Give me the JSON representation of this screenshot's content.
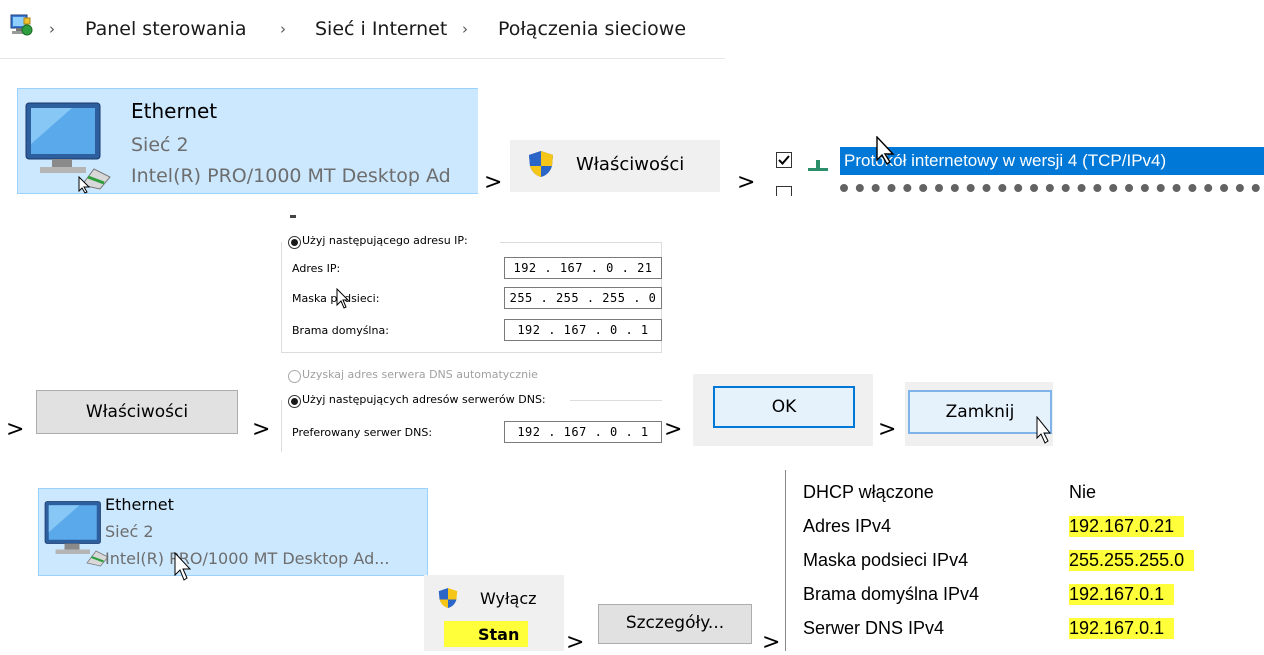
{
  "breadcrumb": {
    "icon": "control-panel-icon",
    "items": [
      "Panel sterowania",
      "Sieć i Internet",
      "Połączenia sieciowe"
    ]
  },
  "adapter": {
    "name": "Ethernet",
    "network": "Sieć 2",
    "device_truncated": "Intel(R) PRO/1000 MT Desktop Ad",
    "device_ellipsis": "Intel(R) PRO/1000 MT Desktop Ad..."
  },
  "menu": {
    "properties": "Właściwości",
    "disable": "Wyłącz",
    "status": "Stan"
  },
  "protocol": {
    "checked": true,
    "label": "Protokół internetowy w wersji 4 (TCP/IPv4)"
  },
  "ip_form": {
    "use_ip_label": "Użyj następującego adresu IP:",
    "ip_label": "Adres IP:",
    "ip_value": "192 . 167 .  0  . 21",
    "mask_label": "Maska podsieci:",
    "mask_value": "255 . 255 . 255 .  0",
    "gateway_label": "Brama domyślna:",
    "gateway_value": "192 . 167 .  0  .  1",
    "dns_auto_label": "Uzyskaj adres serwera DNS automatycznie",
    "dns_manual_label": "Użyj następujących adresów serwerów DNS:",
    "dns_pref_label": "Preferowany serwer DNS:",
    "dns_pref_value": "192 . 167 .  0  .  1"
  },
  "buttons": {
    "properties": "Właściwości",
    "ok": "OK",
    "close": "Zamknij",
    "details": "Szczegóły..."
  },
  "separator": ">",
  "details": [
    {
      "label": "DHCP włączone",
      "value": "Nie",
      "highlight": false
    },
    {
      "label": "Adres IPv4",
      "value": "192.167.0.21",
      "highlight": true
    },
    {
      "label": "Maska podsieci IPv4",
      "value": "255.255.255.0",
      "highlight": true
    },
    {
      "label": "Brama domyślna IPv4",
      "value": "192.167.0.1",
      "highlight": true
    },
    {
      "label": "Serwer DNS IPv4",
      "value": "192.167.0.1",
      "highlight": true
    }
  ],
  "colors": {
    "selection_blue": "#0078d7",
    "tile_bg": "#cce8ff",
    "highlight_yellow": "#ffff3a"
  }
}
